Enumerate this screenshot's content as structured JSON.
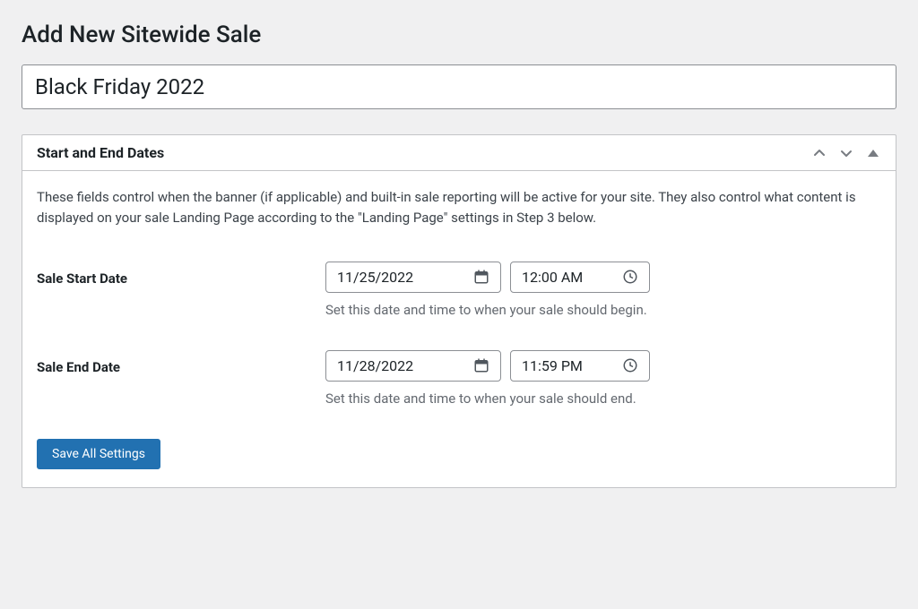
{
  "page": {
    "title": "Add New Sitewide Sale"
  },
  "sale": {
    "title_value": "Black Friday 2022"
  },
  "panel": {
    "title": "Start and End Dates",
    "description": "These fields control when the banner (if applicable) and built-in sale reporting will be active for your site. They also control what content is displayed on your sale Landing Page according to the \"Landing Page\" settings in Step 3 below.",
    "start_date": {
      "label": "Sale Start Date",
      "date": "11/25/2022",
      "time": "12:00 AM",
      "helper": "Set this date and time to when your sale should begin."
    },
    "end_date": {
      "label": "Sale End Date",
      "date": "11/28/2022",
      "time": "11:59 PM",
      "helper": "Set this date and time to when your sale should end."
    },
    "save_label": "Save All Settings"
  }
}
